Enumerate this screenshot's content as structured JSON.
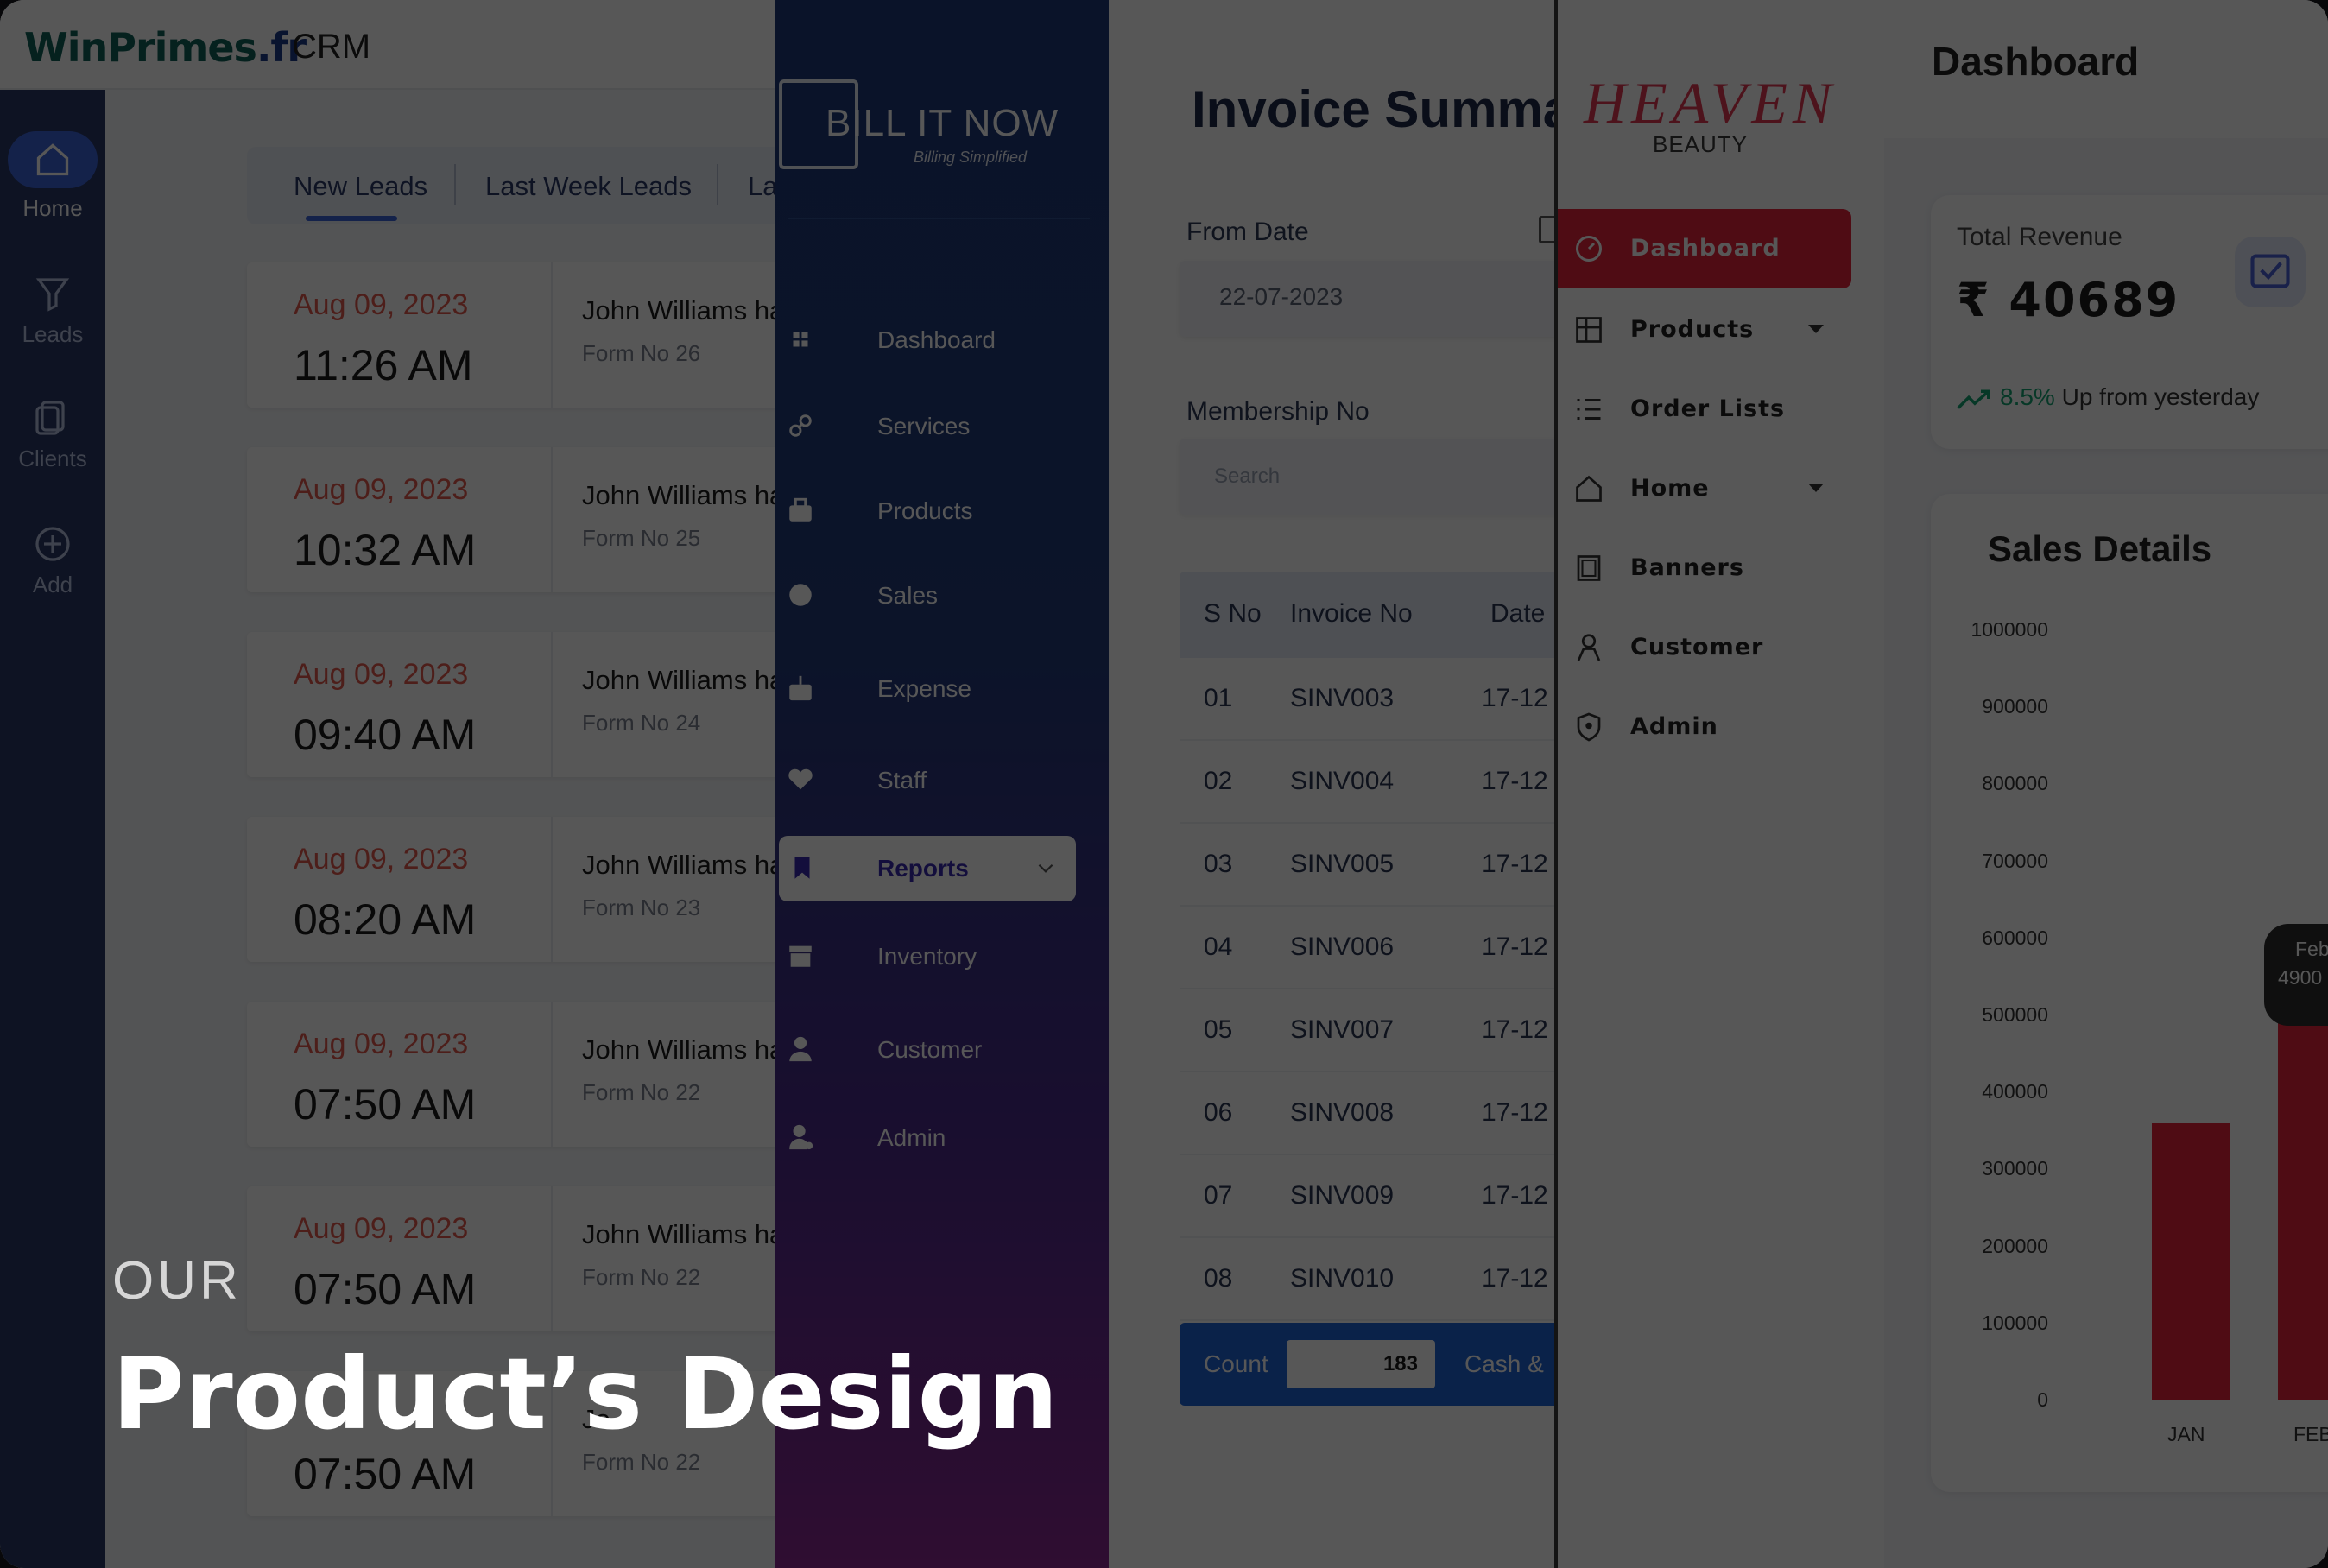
{
  "crm": {
    "logo_main": "WinPrimes",
    "logo_tld": ".fr",
    "title": "CRM",
    "sidebar": [
      {
        "label": "Home",
        "icon": "home-icon"
      },
      {
        "label": "Leads",
        "icon": "filter-icon"
      },
      {
        "label": "Clients",
        "icon": "document-icon"
      },
      {
        "label": "Add",
        "icon": "plus-circle-icon"
      }
    ],
    "tabs": [
      "New Leads",
      "Last Week Leads",
      "La"
    ],
    "leads": [
      {
        "date": "Aug 09, 2023",
        "time": "11:26 AM",
        "who": "John Williams ha",
        "form": "Form No 26"
      },
      {
        "date": "Aug 09, 2023",
        "time": "10:32 AM",
        "who": "John Williams ha",
        "form": "Form No 25"
      },
      {
        "date": "Aug 09, 2023",
        "time": "09:40 AM",
        "who": "John Williams ha",
        "form": "Form No 24"
      },
      {
        "date": "Aug 09, 2023",
        "time": "08:20 AM",
        "who": "John Williams ha",
        "form": "Form No 23"
      },
      {
        "date": "Aug 09, 2023",
        "time": "07:50 AM",
        "who": "John Williams ha",
        "form": "Form No 22"
      },
      {
        "date": "Aug 09, 2023",
        "time": "07:50 AM",
        "who": "John Williams ha",
        "form": "Form No 22"
      },
      {
        "date": "",
        "time": "07:50 AM",
        "who": "Jo",
        "form": "Form No 22"
      }
    ],
    "colors": {
      "sidebar": "#2b3a67",
      "accent": "#3d64d8",
      "date": "#e05a4e"
    }
  },
  "bill": {
    "logo": "BILL IT NOW",
    "tagline": "Billing Simplified",
    "menu": [
      {
        "label": "Dashboard",
        "icon": "grid-icon"
      },
      {
        "label": "Services",
        "icon": "link-icon"
      },
      {
        "label": "Products",
        "icon": "box-icon"
      },
      {
        "label": "Sales",
        "icon": "coin-icon"
      },
      {
        "label": "Expense",
        "icon": "money-bag-icon"
      },
      {
        "label": "Staff",
        "icon": "heart-icon"
      },
      {
        "label": "Reports",
        "icon": "bookmark-icon",
        "active": true
      },
      {
        "label": "Inventory",
        "icon": "archive-icon"
      },
      {
        "label": "Customer",
        "icon": "person-icon"
      },
      {
        "label": "Admin",
        "icon": "admin-icon"
      }
    ]
  },
  "invoice": {
    "title": "Invoice Summar",
    "from_date_label": "From Date",
    "from_date_value": "22-07-2023",
    "membership_label": "Membership No",
    "search_placeholder": "Search",
    "columns": [
      "S No",
      "Invoice No",
      "Date"
    ],
    "rows": [
      [
        "01",
        "SINV003",
        "17-12"
      ],
      [
        "02",
        "SINV004",
        "17-12"
      ],
      [
        "03",
        "SINV005",
        "17-12"
      ],
      [
        "04",
        "SINV006",
        "17-12"
      ],
      [
        "05",
        "SINV007",
        "17-12"
      ],
      [
        "06",
        "SINV008",
        "17-12"
      ],
      [
        "07",
        "SINV009",
        "17-12"
      ],
      [
        "08",
        "SINV010",
        "17-12"
      ]
    ],
    "count_label": "Count",
    "count_value": "183",
    "cash_label": "Cash &"
  },
  "heaven": {
    "logo": "HEAVEN",
    "sub": "BEAUTY",
    "menu": [
      {
        "label": "Dashboard",
        "icon": "gauge-icon",
        "active": true
      },
      {
        "label": "Products",
        "icon": "grid-icon",
        "caret": true
      },
      {
        "label": "Order Lists",
        "icon": "list-icon"
      },
      {
        "label": "Home",
        "icon": "home-icon",
        "caret": true
      },
      {
        "label": "Banners",
        "icon": "banner-icon"
      },
      {
        "label": "Customer",
        "icon": "person-icon"
      },
      {
        "label": "Admin",
        "icon": "shield-icon"
      }
    ],
    "accent": "#e8243c"
  },
  "dashboard": {
    "title": "Dashboard",
    "total_revenue_label": "Total Revenue",
    "total_revenue_value": "₹ 40689",
    "trend_pct": "8.5%",
    "trend_text": " Up from yesterday",
    "sales_title": "Sales Details",
    "tooltip_label": "Feb",
    "tooltip_value": "4900"
  },
  "chart_data": {
    "type": "bar",
    "title": "Sales Details",
    "categories": [
      "JAN",
      "FEB"
    ],
    "values": [
      360000,
      490000
    ],
    "yticks": [
      0,
      100000,
      200000,
      300000,
      400000,
      500000,
      600000,
      700000,
      800000,
      900000,
      1000000
    ],
    "ylim": [
      0,
      1000000
    ],
    "color": "#e8243c",
    "grid": false
  },
  "headline": {
    "eyebrow": "OUR",
    "title": "Product’s Design"
  }
}
